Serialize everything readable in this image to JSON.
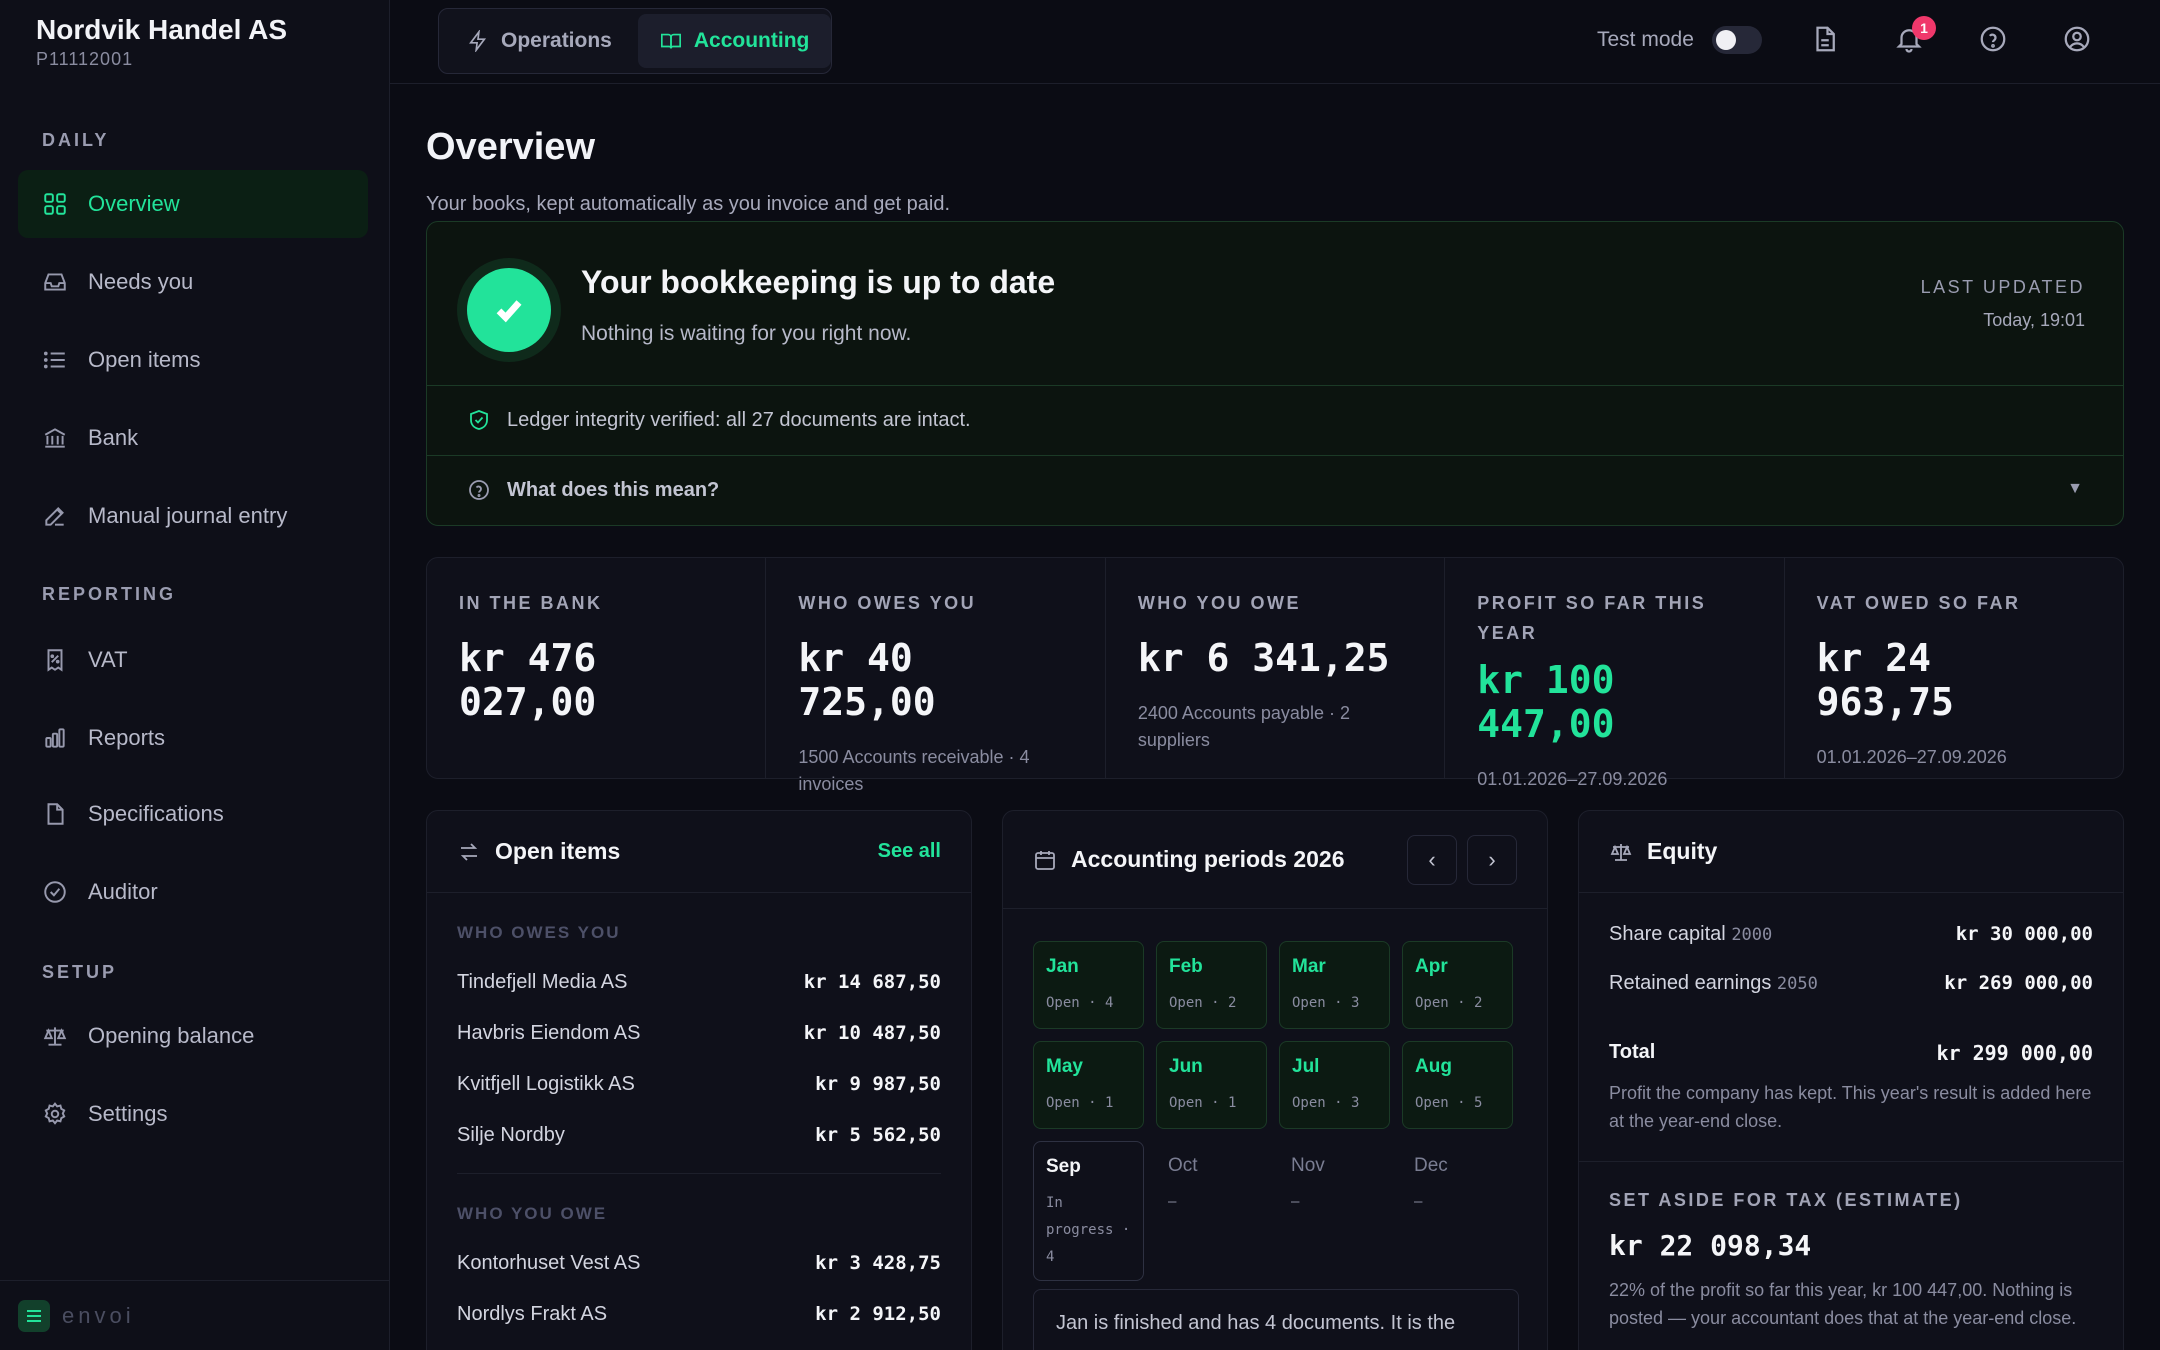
{
  "company": {
    "name": "Nordvik Handel AS",
    "id": "P11112001"
  },
  "sidebar": {
    "sections": {
      "daily": "DAILY",
      "reporting": "REPORTING",
      "setup": "SETUP"
    },
    "items": [
      {
        "label": "Overview",
        "icon": "grid-icon",
        "active": true
      },
      {
        "label": "Needs you",
        "icon": "inbox-icon"
      },
      {
        "label": "Open items",
        "icon": "list-icon"
      },
      {
        "label": "Bank",
        "icon": "bank-icon"
      },
      {
        "label": "Manual journal entry",
        "icon": "pencil-icon"
      },
      {
        "label": "VAT",
        "icon": "receipt-percent-icon"
      },
      {
        "label": "Reports",
        "icon": "bar-chart-icon"
      },
      {
        "label": "Specifications",
        "icon": "file-icon"
      },
      {
        "label": "Auditor",
        "icon": "check-circle-icon"
      },
      {
        "label": "Opening balance",
        "icon": "scale-icon"
      },
      {
        "label": "Settings",
        "icon": "gear-icon"
      }
    ],
    "footer_brand": "envoi"
  },
  "topbar": {
    "tabs": [
      {
        "label": "Operations",
        "icon": "lightning-icon"
      },
      {
        "label": "Accounting",
        "icon": "book-icon",
        "active": true
      }
    ],
    "test_mode_label": "Test mode",
    "notification_count": "1"
  },
  "page": {
    "title": "Overview",
    "subtitle": "Your books, kept automatically as you invoice and get paid."
  },
  "status": {
    "title": "Your bookkeeping is up to date",
    "subtitle": "Nothing is waiting for you right now.",
    "last_updated_label": "LAST UPDATED",
    "last_updated_value": "Today, 19:01",
    "integrity": "Ledger integrity verified: all 27 documents are intact.",
    "explain": "What does this mean?"
  },
  "metrics": [
    {
      "label": "IN THE BANK",
      "value": "kr 476 027,00",
      "sub": ""
    },
    {
      "label": "WHO OWES YOU",
      "value": "kr 40 725,00",
      "sub": "1500 Accounts receivable · 4 invoices"
    },
    {
      "label": "WHO YOU OWE",
      "value": "kr 6 341,25",
      "sub": "2400 Accounts payable · 2 suppliers"
    },
    {
      "label": "PROFIT SO FAR THIS YEAR",
      "value": "kr 100 447,00",
      "sub": "01.01.2026–27.09.2026"
    },
    {
      "label": "VAT OWED SO FAR",
      "value": "kr 24 963,75",
      "sub": "01.01.2026–27.09.2026"
    }
  ],
  "open_items": {
    "title": "Open items",
    "see_all": "See all",
    "owes_you_label": "WHO OWES YOU",
    "owes_you": [
      {
        "name": "Tindefjell Media AS",
        "amount": "kr 14 687,50"
      },
      {
        "name": "Havbris Eiendom AS",
        "amount": "kr 10 487,50"
      },
      {
        "name": "Kvitfjell Logistikk AS",
        "amount": "kr 9 987,50"
      },
      {
        "name": "Silje Nordby",
        "amount": "kr 5 562,50"
      }
    ],
    "you_owe_label": "WHO YOU OWE",
    "you_owe": [
      {
        "name": "Kontorhuset Vest AS",
        "amount": "kr 3 428,75"
      },
      {
        "name": "Nordlys Frakt AS",
        "amount": "kr 2 912,50"
      }
    ]
  },
  "periods": {
    "title": "Accounting periods 2026",
    "prev": "‹",
    "next": "›",
    "months": [
      {
        "name": "Jan",
        "status": "Open · 4",
        "state": "open"
      },
      {
        "name": "Feb",
        "status": "Open · 2",
        "state": "open"
      },
      {
        "name": "Mar",
        "status": "Open · 3",
        "state": "open"
      },
      {
        "name": "Apr",
        "status": "Open · 2",
        "state": "open"
      },
      {
        "name": "May",
        "status": "Open · 1",
        "state": "open"
      },
      {
        "name": "Jun",
        "status": "Open · 1",
        "state": "open"
      },
      {
        "name": "Jul",
        "status": "Open · 3",
        "state": "open"
      },
      {
        "name": "Aug",
        "status": "Open · 5",
        "state": "open"
      },
      {
        "name": "Sep",
        "status": "In progress · 4",
        "state": "progress"
      },
      {
        "name": "Oct",
        "status": "–",
        "state": "future"
      },
      {
        "name": "Nov",
        "status": "–",
        "state": "future"
      },
      {
        "name": "Dec",
        "status": "–",
        "state": "future"
      }
    ],
    "note": "Jan is finished and has 4 documents. It is the"
  },
  "equity": {
    "title": "Equity",
    "rows": [
      {
        "label": "Share capital",
        "account": "2000",
        "amount": "kr 30 000,00"
      },
      {
        "label": "Retained earnings",
        "account": "2050",
        "amount": "kr 269 000,00"
      }
    ],
    "total_label": "Total",
    "total_amount": "kr 299 000,00",
    "note": "Profit the company has kept. This year's result is added here at the year-end close.",
    "tax_label": "SET ASIDE FOR TAX (ESTIMATE)",
    "tax_value": "kr 22 098,34",
    "tax_note": "22% of the profit so far this year, kr 100 447,00. Nothing is posted — your accountant does that at the year-end close."
  }
}
